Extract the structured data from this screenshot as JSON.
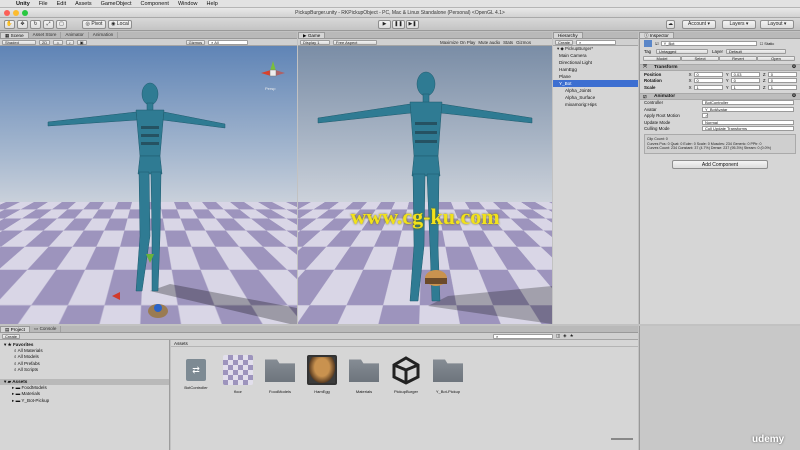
{
  "macbar": {
    "app": "Unity",
    "menus": [
      "File",
      "Edit",
      "Assets",
      "GameObject",
      "Component",
      "Window",
      "Help"
    ]
  },
  "window": {
    "title": "PickupBurger.unity - RKPickupObject - PC, Mac & Linux Standalone (Personal) <OpenGL 4.1>"
  },
  "toolbar": {
    "pivot": "Pivot",
    "local": "Local",
    "account": "Account",
    "layers": "Layers",
    "layout": "Layout"
  },
  "scene": {
    "tabs": [
      "Scene",
      "Asset Store",
      "Animator",
      "Animation"
    ],
    "shading": "Shaded",
    "mode": "2D",
    "gizmos": "Gizmos",
    "search": "All",
    "persp": "Persp"
  },
  "game": {
    "tab": "Game",
    "display": "Display 1",
    "aspect": "Free Aspect",
    "options": [
      "Maximize On Play",
      "Mute audio",
      "Stats",
      "Gizmos"
    ],
    "watermark": "www.cg-ku.com"
  },
  "hierarchy": {
    "tab": "Hierarchy",
    "create": "Create",
    "items": [
      {
        "label": "Main Camera",
        "indent": 0,
        "sel": false
      },
      {
        "label": "Directional Light",
        "indent": 0,
        "sel": false
      },
      {
        "label": "HamEgg",
        "indent": 0,
        "sel": false
      },
      {
        "label": "Plane",
        "indent": 0,
        "sel": false
      },
      {
        "label": "Y_Bot",
        "indent": 0,
        "sel": true
      },
      {
        "label": "Alpha_Joints",
        "indent": 1,
        "sel": false
      },
      {
        "label": "Alpha_Surface",
        "indent": 1,
        "sel": false
      },
      {
        "label": "mixamorig:Hips",
        "indent": 1,
        "sel": false
      }
    ]
  },
  "inspector": {
    "tab": "Inspector",
    "name": "Y_Bot",
    "static": "Static",
    "tag_label": "Tag",
    "tag": "Untagged",
    "layer_label": "Layer",
    "layer": "Default",
    "prefab_buttons": [
      "Model",
      "Select",
      "Revert",
      "Open"
    ],
    "transform": {
      "title": "Transform",
      "rows": [
        {
          "label": "Position",
          "x": "0",
          "y": "0.03",
          "z": "0"
        },
        {
          "label": "Rotation",
          "x": "0",
          "y": "0",
          "z": "0"
        },
        {
          "label": "Scale",
          "x": "1",
          "y": "1",
          "z": "1"
        }
      ]
    },
    "animator": {
      "title": "Animator",
      "rows": [
        {
          "label": "Controller",
          "value": "BotController"
        },
        {
          "label": "Avatar",
          "value": "Y_BotAvatar"
        },
        {
          "label": "Apply Root Motion",
          "value": "✓"
        },
        {
          "label": "Update Mode",
          "value": "Normal"
        },
        {
          "label": "Culling Mode",
          "value": "Cull Update Transforms"
        }
      ],
      "info": [
        "Clip Count: 0",
        "Curves Pos: 0 Quat: 0 Euler: 0 Scale: 0 Muscles: 234 Generic: 0 PPtr: 0",
        "Curves Count: 234 Constant: 37 (4.7%) Dense: 237 (95.3%) Stream: 0 (0.0%)"
      ]
    },
    "add_component": "Add Component"
  },
  "project": {
    "tabs": [
      "Project",
      "Console"
    ],
    "create": "Create",
    "favorites": {
      "label": "Favorites",
      "items": [
        "All Materials",
        "All Models",
        "All Prefabs",
        "All Scripts"
      ]
    },
    "assets": {
      "label": "Assets",
      "items": [
        "FoodModels",
        "Materials",
        "Y_Bot-Pickup"
      ]
    },
    "breadcrumb": "Assets",
    "files": [
      {
        "name": "BotController",
        "kind": "controller"
      },
      {
        "name": "floor",
        "kind": "checker"
      },
      {
        "name": "FoodModels",
        "kind": "folder"
      },
      {
        "name": "HamEgg",
        "kind": "burger"
      },
      {
        "name": "Materials",
        "kind": "folder"
      },
      {
        "name": "PickupBurger",
        "kind": "unity"
      },
      {
        "name": "Y_Bot-Pickup",
        "kind": "folder"
      }
    ]
  },
  "brand": "udemy",
  "colors": {
    "selection": "#3d6fd1",
    "bot": "#2f7b93",
    "sky": "#5f84b6",
    "checker": "#9d94bd"
  }
}
